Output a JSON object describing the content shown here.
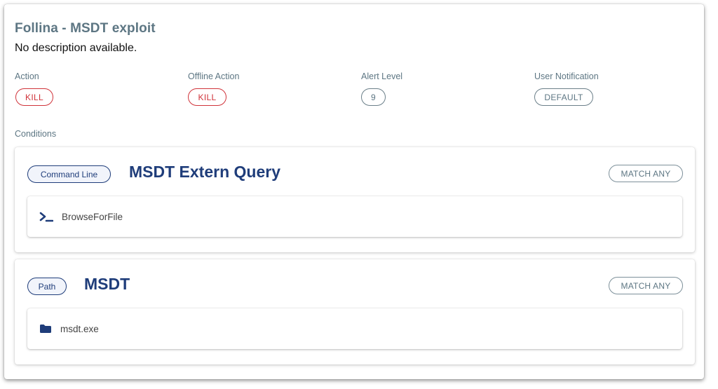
{
  "rule": {
    "title": "Follina - MSDT exploit",
    "description": "No description available."
  },
  "fields": {
    "action": {
      "label": "Action",
      "value": "KILL"
    },
    "offline_action": {
      "label": "Offline Action",
      "value": "KILL"
    },
    "alert_level": {
      "label": "Alert Level",
      "value": "9"
    },
    "user_notification": {
      "label": "User Notification",
      "value": "DEFAULT"
    }
  },
  "conditions_label": "Conditions",
  "conditions": [
    {
      "type_label": "Command Line",
      "title": "MSDT Extern Query",
      "match_label": "MATCH ANY",
      "icon": "terminal-icon",
      "value": "BrowseForFile"
    },
    {
      "type_label": "Path",
      "title": "MSDT",
      "match_label": "MATCH ANY",
      "icon": "folder-icon",
      "value": "msdt.exe"
    }
  ],
  "colors": {
    "danger": "#d0333a",
    "primary": "#1f3d7a",
    "muted": "#5d7683"
  }
}
